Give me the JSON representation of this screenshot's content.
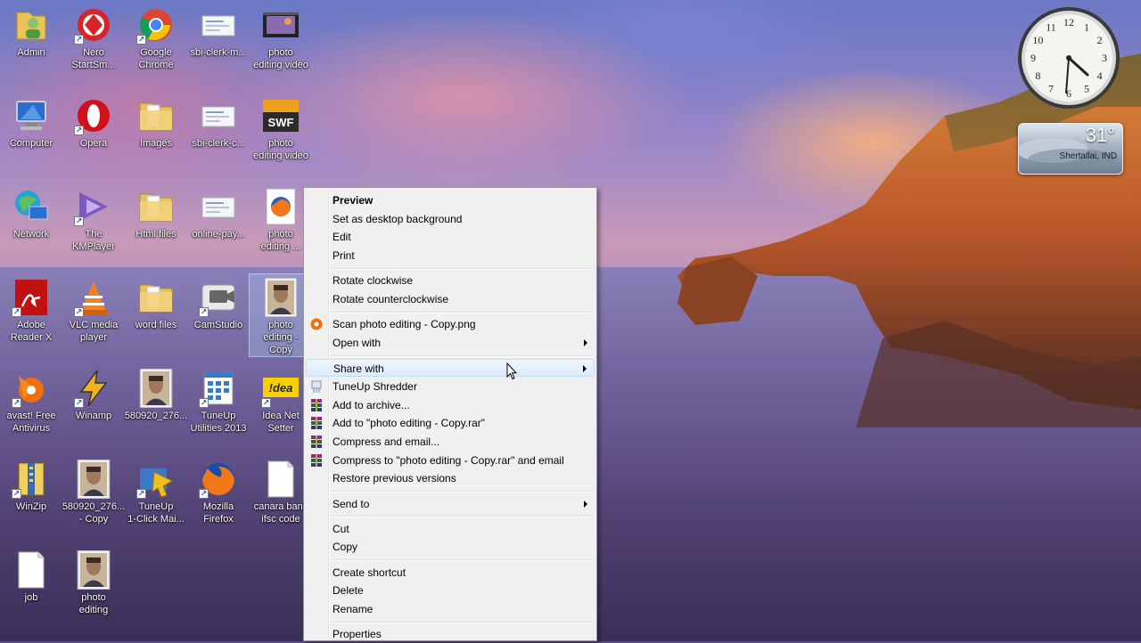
{
  "desktop_icons": [
    {
      "label": "Admin",
      "icon": "user-folder-icon",
      "shortcut": false
    },
    {
      "label": "Nero\nStartSm...",
      "icon": "nero-icon",
      "shortcut": true
    },
    {
      "label": "Google\nChrome",
      "icon": "chrome-icon",
      "shortcut": true
    },
    {
      "label": "sbi-clerk-m...",
      "icon": "document-icon",
      "shortcut": false
    },
    {
      "label": "photo\nediting video",
      "icon": "video-file-icon",
      "shortcut": false
    },
    {
      "label": "Computer",
      "icon": "computer-icon",
      "shortcut": false
    },
    {
      "label": "Opera",
      "icon": "opera-icon",
      "shortcut": true
    },
    {
      "label": "Images",
      "icon": "folder-icon",
      "shortcut": false
    },
    {
      "label": "sbi-clerk-c...",
      "icon": "document-icon",
      "shortcut": false
    },
    {
      "label": "photo\nediting video",
      "icon": "swf-icon",
      "shortcut": false
    },
    {
      "label": "Network",
      "icon": "network-icon",
      "shortcut": false
    },
    {
      "label": "The\nKMPlayer",
      "icon": "kmplayer-icon",
      "shortcut": true
    },
    {
      "label": "Html files",
      "icon": "folder-icon",
      "shortcut": false
    },
    {
      "label": "online-pay...",
      "icon": "document-icon",
      "shortcut": false
    },
    {
      "label": "photo\nediting ...",
      "icon": "firefox-file-icon",
      "shortcut": false
    },
    {
      "label": "Adobe\nReader X",
      "icon": "adobe-reader-icon",
      "shortcut": true
    },
    {
      "label": "VLC media\nplayer",
      "icon": "vlc-icon",
      "shortcut": true
    },
    {
      "label": "word files",
      "icon": "folder-icon",
      "shortcut": false
    },
    {
      "label": "CamStudio",
      "icon": "camstudio-icon",
      "shortcut": true
    },
    {
      "label": "photo\nediting -\nCopy",
      "icon": "photo-thumbnail-icon",
      "shortcut": false
    },
    {
      "label": "avast! Free\nAntivirus",
      "icon": "avast-icon",
      "shortcut": true
    },
    {
      "label": "Winamp",
      "icon": "winamp-icon",
      "shortcut": true
    },
    {
      "label": "580920_276...",
      "icon": "photo-thumbnail-icon",
      "shortcut": false
    },
    {
      "label": "TuneUp\nUtilities 2013",
      "icon": "tuneup-icon",
      "shortcut": true
    },
    {
      "label": "Idea Net\nSetter",
      "icon": "idea-icon",
      "shortcut": true
    },
    {
      "label": "WinZip",
      "icon": "winzip-icon",
      "shortcut": true
    },
    {
      "label": "580920_276...\n- Copy",
      "icon": "photo-thumbnail-icon",
      "shortcut": false
    },
    {
      "label": "TuneUp\n1-Click Mai...",
      "icon": "tuneup-maintenance-icon",
      "shortcut": true
    },
    {
      "label": "Mozilla\nFirefox",
      "icon": "firefox-icon",
      "shortcut": true
    },
    {
      "label": "canara bank\nifsc code",
      "icon": "text-file-icon",
      "shortcut": false
    },
    {
      "label": "job",
      "icon": "text-file-icon",
      "shortcut": false
    },
    {
      "label": "photo\nediting",
      "icon": "photo-thumbnail-icon",
      "shortcut": false
    }
  ],
  "selected_icon": "photo\nediting -\nCopy",
  "context_menu": {
    "items": [
      {
        "label": "Preview",
        "bold": true
      },
      {
        "label": "Set as desktop background"
      },
      {
        "label": "Edit"
      },
      {
        "label": "Print"
      },
      {
        "separator": true
      },
      {
        "label": "Rotate clockwise"
      },
      {
        "label": "Rotate counterclockwise"
      },
      {
        "separator": true
      },
      {
        "label": "Scan photo editing - Copy.png",
        "icon": "avast-scan-icon"
      },
      {
        "label": "Open with",
        "submenu": true
      },
      {
        "separator": true
      },
      {
        "label": "Share with",
        "submenu": true,
        "highlighted": true
      },
      {
        "label": "TuneUp Shredder",
        "icon": "shredder-icon"
      },
      {
        "label": "Add to archive...",
        "icon": "winrar-icon"
      },
      {
        "label": "Add to \"photo editing - Copy.rar\"",
        "icon": "winrar-icon"
      },
      {
        "label": "Compress and email...",
        "icon": "winrar-icon"
      },
      {
        "label": "Compress to \"photo editing - Copy.rar\" and email",
        "icon": "winrar-icon"
      },
      {
        "label": "Restore previous versions"
      },
      {
        "separator": true
      },
      {
        "label": "Send to",
        "submenu": true
      },
      {
        "separator": true
      },
      {
        "label": "Cut"
      },
      {
        "label": "Copy"
      },
      {
        "separator": true
      },
      {
        "label": "Create shortcut"
      },
      {
        "label": "Delete"
      },
      {
        "label": "Rename"
      },
      {
        "separator": true
      },
      {
        "label": "Properties"
      }
    ]
  },
  "gadgets": {
    "clock": {
      "hour_numerals": [
        "12",
        "1",
        "2",
        "3",
        "4",
        "5",
        "6",
        "7",
        "8",
        "9",
        "10",
        "11"
      ],
      "time": "4:27"
    },
    "weather": {
      "temperature": "31°",
      "location": "Shertallai, IND"
    }
  },
  "colors": {
    "menu_bg": "#f0f0f0",
    "menu_highlight": "#dcebfc",
    "label_text": "#ffffff"
  }
}
